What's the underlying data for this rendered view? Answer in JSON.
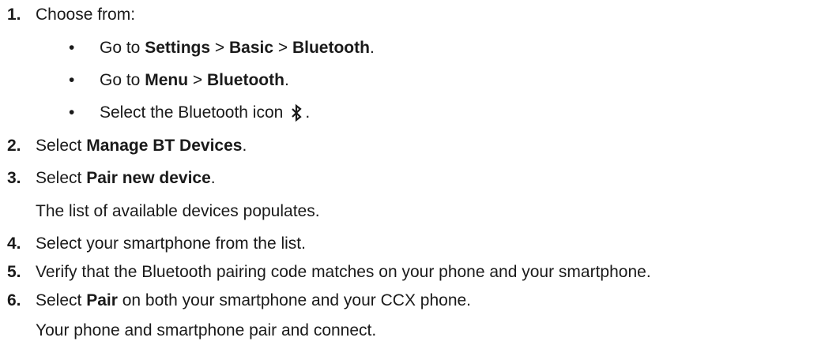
{
  "steps": [
    {
      "number": "1.",
      "text": "Choose from:"
    },
    {
      "number": "2.",
      "prefix": "Select ",
      "bold": "Manage BT Devices",
      "suffix": "."
    },
    {
      "number": "3.",
      "prefix": "Select ",
      "bold": "Pair new device",
      "suffix": ".",
      "result": "The list of available devices populates."
    },
    {
      "number": "4.",
      "text": "Select your smartphone from the list."
    },
    {
      "number": "5.",
      "text": "Verify that the Bluetooth pairing code matches on your phone and your smartphone."
    },
    {
      "number": "6.",
      "prefix": "Select ",
      "bold": "Pair",
      "suffix": " on both your smartphone and your CCX phone.",
      "result": "Your phone and smartphone pair and connect."
    }
  ],
  "options": [
    {
      "bullet": "•",
      "p1": "Go to ",
      "b1": "Settings",
      "sep1": " > ",
      "b2": "Basic",
      "sep2": " > ",
      "b3": "Bluetooth",
      "end": "."
    },
    {
      "bullet": "•",
      "p1": "Go to ",
      "b1": "Menu",
      "sep1": " > ",
      "b2": "Bluetooth",
      "end": "."
    },
    {
      "bullet": "•",
      "p1": "Select the Bluetooth icon",
      "end": ".",
      "icon": "bluetooth-icon"
    }
  ]
}
